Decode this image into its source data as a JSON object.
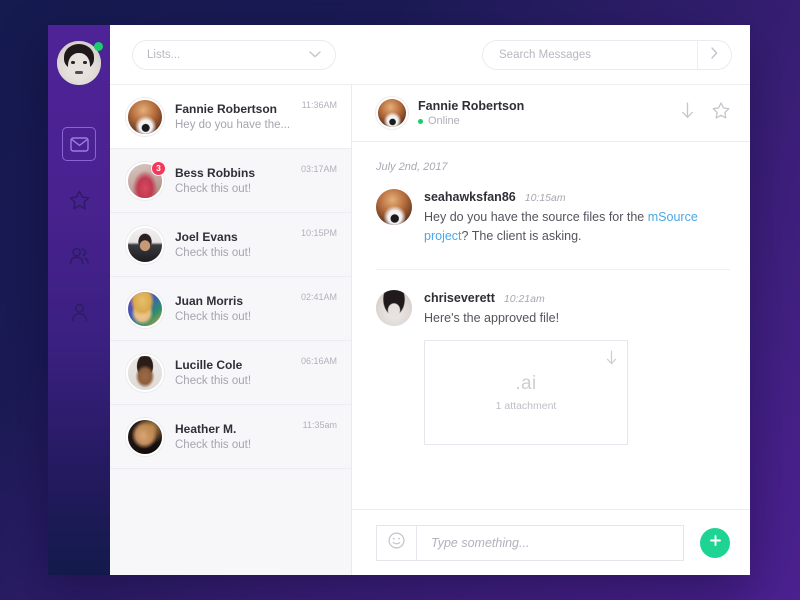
{
  "app": {
    "accent_green": "#1ed492",
    "accent_purple": "#4e2397",
    "badge_red": "#f2395a",
    "link_blue": "#4aa8e8"
  },
  "rail": {
    "user_status": "online",
    "items": [
      {
        "icon": "mail-icon",
        "active": true
      },
      {
        "icon": "star-icon",
        "active": false
      },
      {
        "icon": "group-icon",
        "active": false
      },
      {
        "icon": "person-icon",
        "active": false
      }
    ]
  },
  "topbar": {
    "lists_label": "Lists...",
    "lists_icon": "chevron-down-icon",
    "search_placeholder": "Search Messages",
    "search_value": "",
    "search_go_icon": "chevron-right-icon"
  },
  "conversations": [
    {
      "name": "Fannie Robertson",
      "preview": "Hey do you have the...",
      "time": "11:36AM",
      "selected": true,
      "badge": ""
    },
    {
      "name": "Bess Robbins",
      "preview": "Check this out!",
      "time": "03:17AM",
      "selected": false,
      "badge": "3"
    },
    {
      "name": "Joel Evans",
      "preview": "Check this out!",
      "time": "10:15PM",
      "selected": false,
      "badge": ""
    },
    {
      "name": "Juan Morris",
      "preview": "Check this out!",
      "time": "02:41AM",
      "selected": false,
      "badge": ""
    },
    {
      "name": "Lucille Cole",
      "preview": "Check this out!",
      "time": "06:16AM",
      "selected": false,
      "badge": ""
    },
    {
      "name": "Heather M.",
      "preview": "Check this out!",
      "time": "11:35am",
      "selected": false,
      "badge": ""
    }
  ],
  "chat": {
    "header": {
      "name": "Fannie Robertson",
      "status": "Online",
      "download_icon": "download-arrow-icon",
      "star_icon": "star-icon"
    },
    "daystamp": "July 2nd, 2017",
    "messages": [
      {
        "user": "seahawksfan86",
        "time": "10:15am",
        "text_before": "Hey do you have the source files for the ",
        "link": "mSource project",
        "text_after": "? The client is asking."
      },
      {
        "user": "chriseverett",
        "time": "10:21am",
        "text_before": "Here's the approved file!",
        "link": "",
        "text_after": "",
        "attachment": {
          "extension": ".ai",
          "count_label": "1 attachment",
          "download_icon": "download-arrow-icon"
        }
      }
    ]
  },
  "composer": {
    "emoji_icon": "smiley-icon",
    "placeholder": "Type something...",
    "value": "",
    "send_icon": "plus-icon"
  }
}
